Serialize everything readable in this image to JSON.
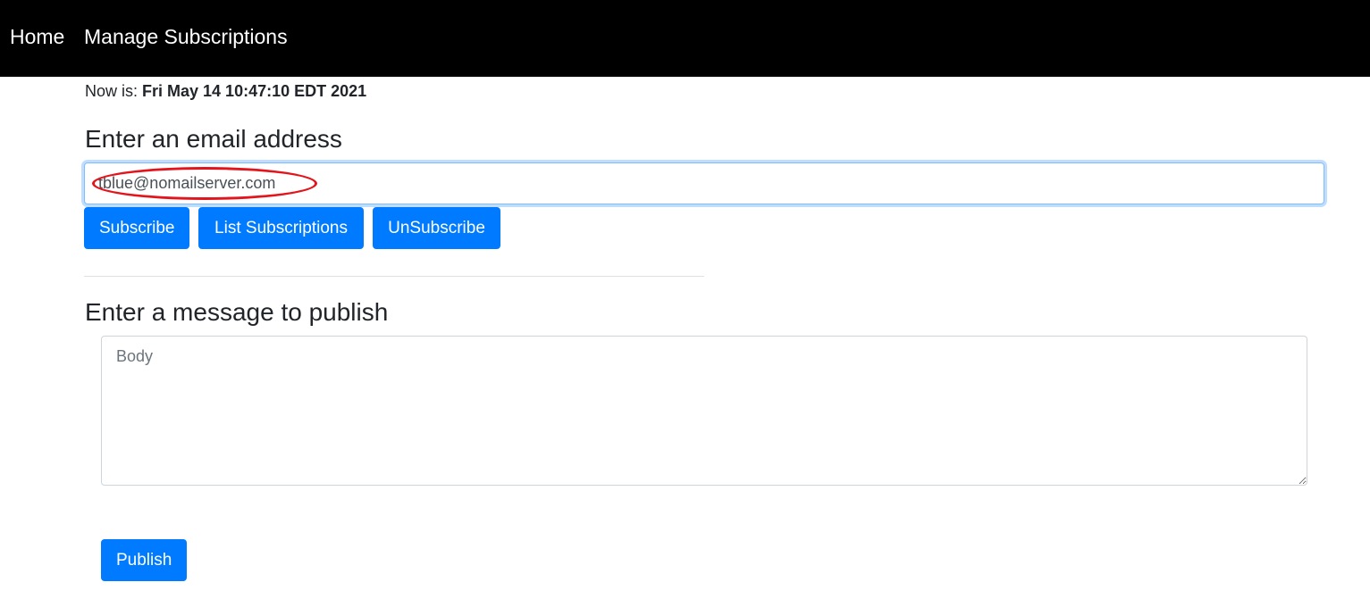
{
  "nav": {
    "home": "Home",
    "manage": "Manage Subscriptions"
  },
  "status": {
    "prefix": "Now is: ",
    "datetime": "Fri May 14 10:47:10 EDT 2021"
  },
  "email_section": {
    "heading": "Enter an email address",
    "input_value": "tblue@nomailserver.com"
  },
  "buttons": {
    "subscribe": "Subscribe",
    "list": "List Subscriptions",
    "unsubscribe": "UnSubscribe",
    "publish": "Publish"
  },
  "message_section": {
    "heading": "Enter a message to publish",
    "body_placeholder": "Body"
  },
  "colors": {
    "navbar": "#000000",
    "primary": "#007bff",
    "annotation": "#e3141b"
  }
}
